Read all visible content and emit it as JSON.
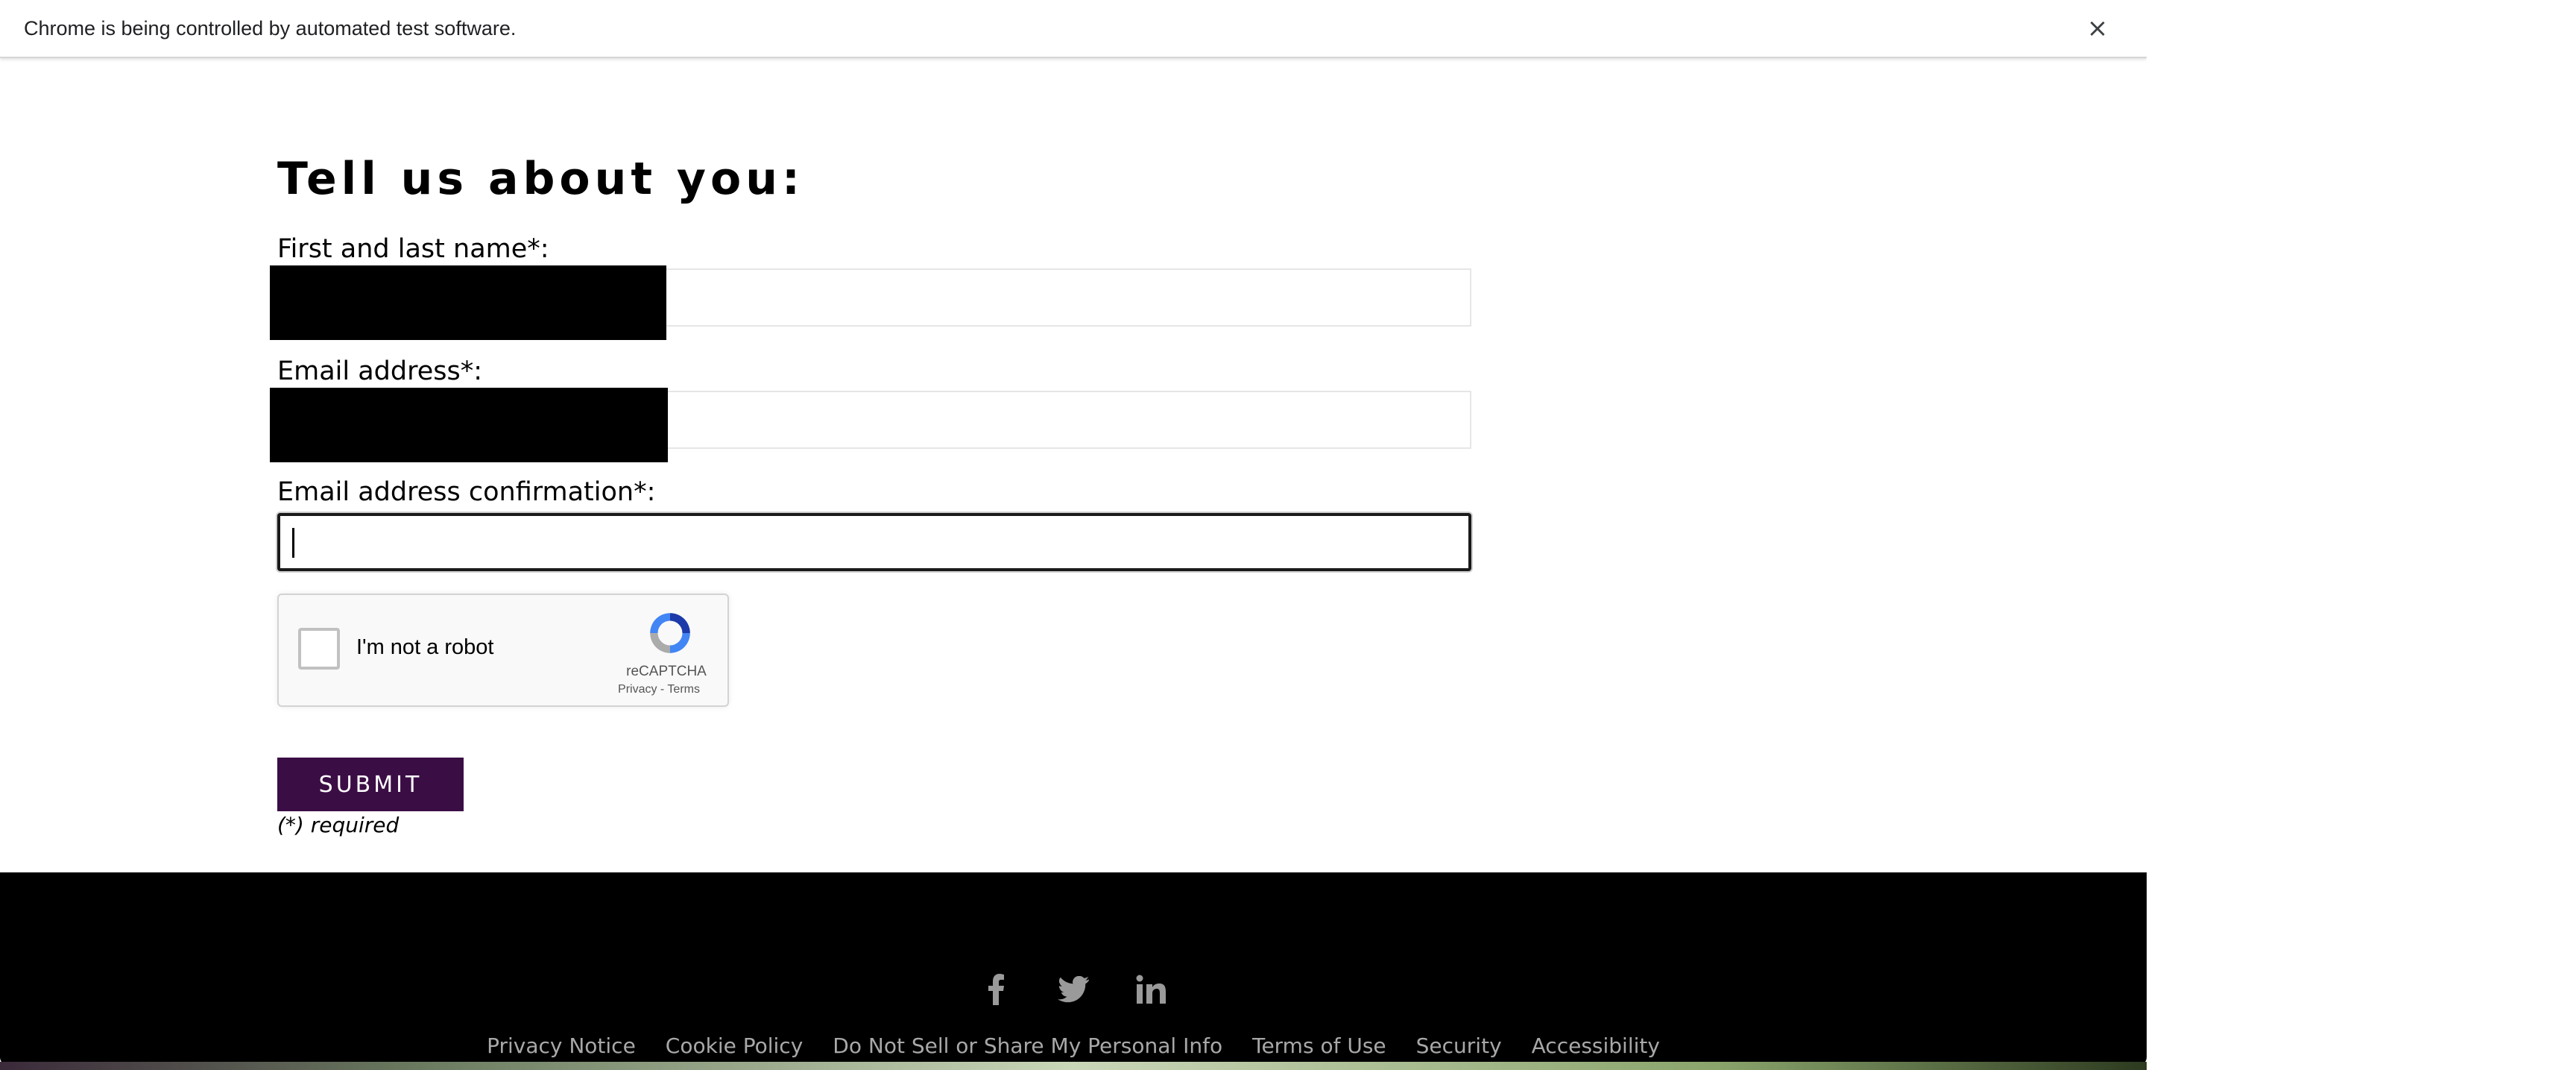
{
  "infobar": {
    "message": "Chrome is being controlled by automated test software.",
    "close_glyph": "×"
  },
  "form": {
    "heading": "Tell us about you:",
    "name_label": "First and last name*:",
    "email_label": "Email address*:",
    "confirm_label": "Email address confirmation*:",
    "name_value": "",
    "email_value": "",
    "confirm_value": "",
    "submit_label": "SUBMIT",
    "required_note": "(*) required"
  },
  "recaptcha": {
    "label": "I'm not a robot",
    "brand": "reCAPTCHA",
    "links": "Privacy - Terms"
  },
  "footer": {
    "social": [
      "facebook-icon",
      "twitter-icon",
      "linkedin-icon"
    ],
    "links": [
      "Privacy Notice",
      "Cookie Policy",
      "Do Not Sell or Share My Personal Info",
      "Terms of Use",
      "Security",
      "Accessibility"
    ]
  },
  "colors": {
    "submit_bg": "#3b0d45",
    "footer_bg": "#000000",
    "footer_link": "#a8a8a8"
  }
}
